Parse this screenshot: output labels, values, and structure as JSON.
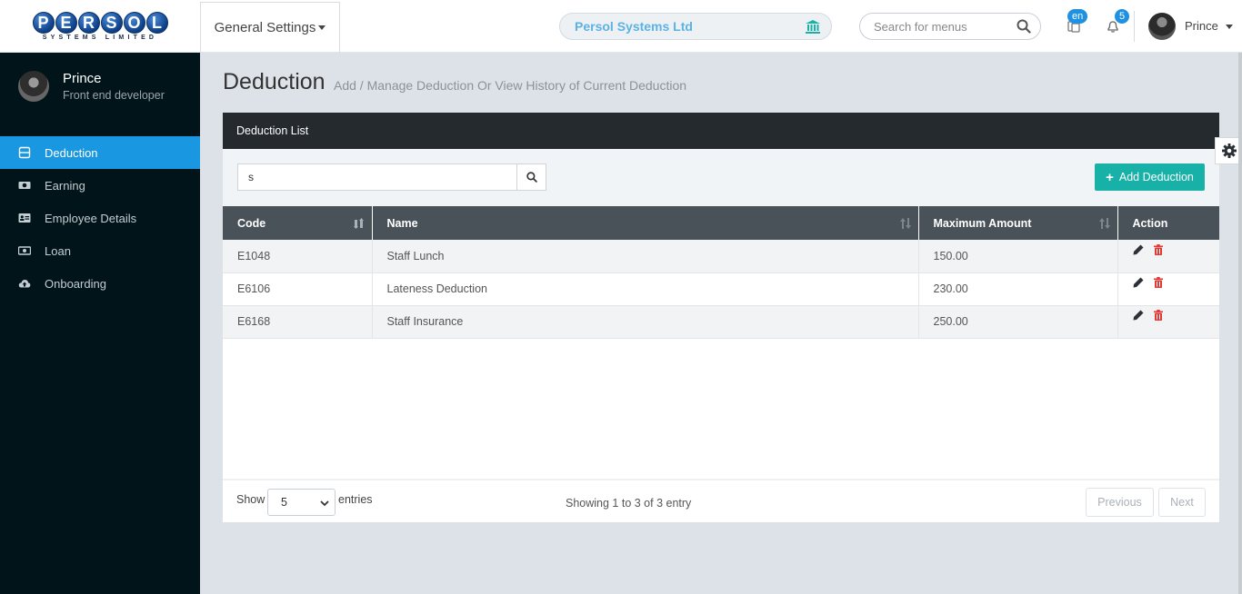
{
  "logo": {
    "letters": [
      "P",
      "E",
      "R",
      "S",
      "O",
      "L"
    ],
    "sub": "SYSTEMS LIMITED"
  },
  "header": {
    "menu_label": "General Settings",
    "company": "Persol Systems Ltd",
    "search_placeholder": "Search for menus",
    "lang_badge": "en",
    "notif_count": "5",
    "user": "Prince"
  },
  "sidebar": {
    "profile": {
      "name": "Prince",
      "role": "Front end developer"
    },
    "items": [
      {
        "label": "Deduction",
        "icon": "list-icon",
        "active": true
      },
      {
        "label": "Earning",
        "icon": "money-icon",
        "active": false
      },
      {
        "label": "Employee Details",
        "icon": "id-card-icon",
        "active": false
      },
      {
        "label": "Loan",
        "icon": "money-icon",
        "active": false
      },
      {
        "label": "Onboarding",
        "icon": "cloud-upload-icon",
        "active": false
      }
    ]
  },
  "page": {
    "title": "Deduction",
    "subtitle": "Add / Manage Deduction Or View History of Current Deduction"
  },
  "card": {
    "title": "Deduction List",
    "search_value": "s",
    "add_label": "Add Deduction",
    "columns": [
      "Code",
      "Name",
      "Maximum Amount",
      "Action"
    ],
    "rows": [
      {
        "code": "E1048",
        "name": "Staff Lunch",
        "amount": "150.00"
      },
      {
        "code": "E6106",
        "name": "Lateness Deduction",
        "amount": "230.00"
      },
      {
        "code": "E6168",
        "name": "Staff Insurance",
        "amount": "250.00"
      }
    ],
    "footer": {
      "show": "Show",
      "page_size": "5",
      "entries": "entries",
      "showing": "Showing 1 to 3 of 3 entry",
      "previous": "Previous",
      "next": "Next"
    }
  },
  "colors": {
    "accent": "#1a97e1",
    "add_button": "#17b1a7",
    "sidebar": "#011419",
    "header_dark": "#252a2f",
    "delete": "#e53935"
  }
}
